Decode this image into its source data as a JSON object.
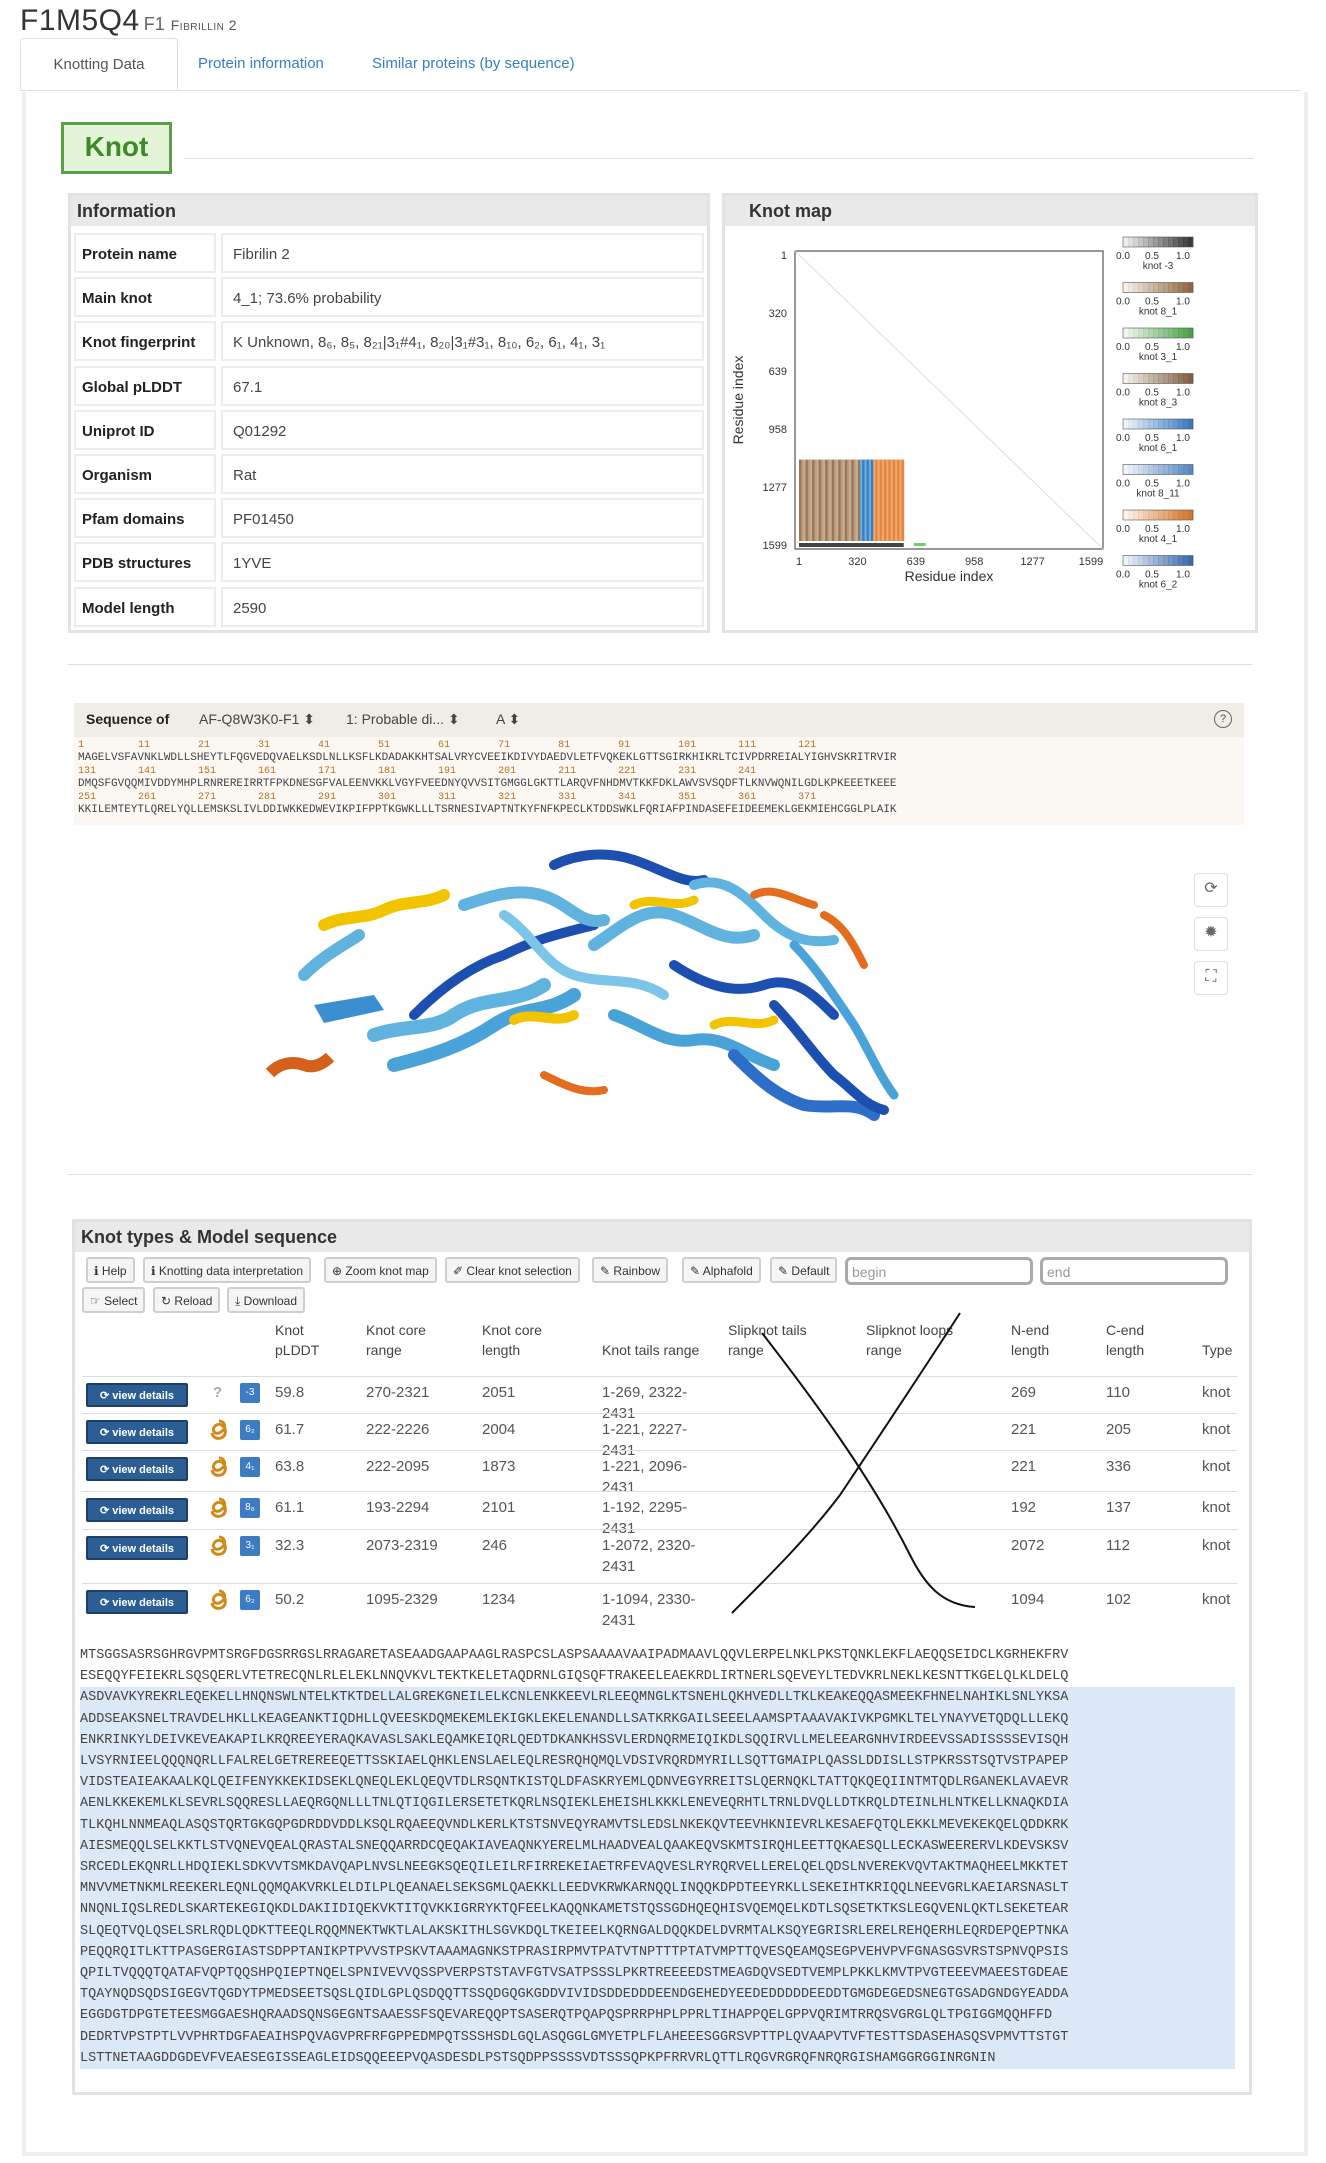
{
  "header": {
    "id": "F1M5Q4",
    "suffix": "F1",
    "name": "Fibrillin 2"
  },
  "tabs": [
    {
      "label": "Knotting Data",
      "active": true
    },
    {
      "label": "Protein information",
      "active": false
    },
    {
      "label": "Similar proteins (by sequence)",
      "active": false
    }
  ],
  "knot_title": "Knot",
  "information": {
    "title": "Information",
    "rows": [
      {
        "key": "Protein name",
        "value": "Fibrilin 2"
      },
      {
        "key": "Main knot",
        "value": "4_1; 73.6% probability"
      },
      {
        "key": "Knot fingerprint",
        "value": "K Unknown, 8₆, 8₅, 8₂₁|3₁#4₁, 8₂₀|3₁#3₁, 8₁₀, 6₂, 6₁, 4₁, 3₁"
      },
      {
        "key": "Global pLDDT",
        "value": "67.1"
      },
      {
        "key": "Uniprot ID",
        "value": "Q01292"
      },
      {
        "key": "Organism",
        "value": "Rat"
      },
      {
        "key": "Pfam domains",
        "value": "PF01450"
      },
      {
        "key": "PDB structures",
        "value": "1YVE"
      },
      {
        "key": "Model length",
        "value": "2590"
      }
    ]
  },
  "knot_map": {
    "title": "Knot map",
    "ylabel": "Residue index",
    "xlabel": "Residue index",
    "yticks": [
      "1",
      "320",
      "639",
      "958",
      "1277",
      "1599"
    ],
    "xticks": [
      "1",
      "320",
      "639",
      "958",
      "1277",
      "1599"
    ],
    "colorbar_ticks": [
      "0.0",
      "0.5",
      "1.0"
    ],
    "colorbars": [
      {
        "label": "knot -3",
        "color": "#2a2a2a"
      },
      {
        "label": "knot 8_1",
        "color": "#8a5a2e"
      },
      {
        "label": "knot 3_1",
        "color": "#3c9a3c"
      },
      {
        "label": "knot 8_3",
        "color": "#7a5230"
      },
      {
        "label": "knot 6_1",
        "color": "#2d6fb8"
      },
      {
        "label": "knot 8_11",
        "color": "#4a7fc0"
      },
      {
        "label": "knot 4_1",
        "color": "#d06a1c"
      },
      {
        "label": "knot 6_2",
        "color": "#2a5ea8"
      }
    ]
  },
  "sequence_viewer": {
    "label": "Sequence of",
    "entry": "AF-Q8W3K0-F1",
    "chain_desc": "1: Probable di...",
    "chain": "A",
    "line1_nums": "1         11        21        31        41        51        61        71        81        91        101       111       121",
    "line1": "MAGELVSFAVNKLWDLLSHEYTLFQGVEDQVAELKSDLNLLKSFLKDADAKKHTSALVRYCVEEIKDIVYDAEDVLETFVQKEKLGTTSGIRKHIKRLTCIVPDRREIALYIGHVSKRITRVIR",
    "line2_nums": "131       141       151       161       171       181       191       201       211       221       231       241",
    "line2": "DMQSFGVQQMIVDDYMHPLRNREREIRRTFPKDNESGFVALEENVKKLVGYFVEEDNYQVVSITGMGGLGKTTLARQVFNHDMVTKKFDKLAWVSVSQDFTLKNVWQNILGDLKPKEEETKEEE",
    "line3_nums": "251       261       271       281       291       301       311       321       331       341       351       361       371",
    "line3": "KKILEMTEYTLQRELYQLLEMSKSLIVLDDIWKKEDWEVIKPIFPPTKGWKLLLTSRNESIVAPTNTKYFNFKPECLKTDDSWKLFQRIAFPINDASEFEIDEEMEKLGEKMIEHCGGLPLAIK"
  },
  "knot_types": {
    "title": "Knot types & Model sequence",
    "buttons": [
      "Help",
      "Knotting data interpretation",
      "Zoom knot map",
      "Clear knot selection",
      "Rainbow",
      "Alphafold",
      "Default",
      "Select",
      "Reload",
      "Download"
    ],
    "begin_placeholder": "begin",
    "end_placeholder": "end",
    "columns": [
      "Knot pLDDT",
      "Knot core range",
      "Knot core length",
      "Knot tails range",
      "Slipknot tails range",
      "Slipknot loops range",
      "N-end length",
      "C-end length",
      "Type"
    ],
    "view_label": "view details",
    "rows": [
      {
        "badge": "-3",
        "icon": "unknown",
        "plddt": "59.8",
        "core": "270-2321",
        "core_len": "2051",
        "tails": "1-269, 2322-2431",
        "n_end": "269",
        "c_end": "110",
        "type": "knot"
      },
      {
        "badge": "6₂",
        "icon": "knot",
        "plddt": "61.7",
        "core": "222-2226",
        "core_len": "2004",
        "tails": "1-221, 2227-2431",
        "n_end": "221",
        "c_end": "205",
        "type": "knot"
      },
      {
        "badge": "4₁",
        "icon": "knot",
        "plddt": "63.8",
        "core": "222-2095",
        "core_len": "1873",
        "tails": "1-221, 2096-2431",
        "n_end": "221",
        "c_end": "336",
        "type": "knot"
      },
      {
        "badge": "8₈",
        "icon": "knot",
        "plddt": "61.1",
        "core": "193-2294",
        "core_len": "2101",
        "tails": "1-192, 2295-2431",
        "n_end": "192",
        "c_end": "137",
        "type": "knot"
      },
      {
        "badge": "3₁",
        "icon": "knot",
        "plddt": "32.3",
        "core": "2073-2319",
        "core_len": "246",
        "tails": "1-2072, 2320-2431",
        "n_end": "2072",
        "c_end": "112",
        "type": "knot"
      },
      {
        "badge": "6₂",
        "icon": "knot",
        "plddt": "50.2",
        "core": "1095-2329",
        "core_len": "1234",
        "tails": "1-1094, 2330-2431",
        "n_end": "1094",
        "c_end": "102",
        "type": "knot"
      }
    ]
  },
  "model_sequence": [
    "MTSGGSASRSGHRGVPMTSRGFDGSRRGSLRRAGARETASEAADGAAPAAGLRASPCSLASPSAAAAVAAIPADMAAVLQQVLERPELNKLPKSTQNKLEKFLAEQQSEIDCLKGRHEKFRV",
    "ESEQQYFEIEKRLSQSQERLVTETRECQNLRLELEKLNNQVKVLTEKTKELETAQDRNLGIQSQFTRAKEELEAEKRDLIRTNERLSQEVEYLTEDVKRLNEKLKESNTTKGELQLKLDELQ",
    "ASDVAVKYREKRLEQEKELLHNQNSWLNTELKTKTDELLALGREKGNEILELKCNLENKKEEVLRLEEQMNGLKTSNEHLQKHVEDLLTKLKEAKEQQASMEEKFHNELNAHIKLSNLYKSA",
    "ADDSEAKSNELTRAVDELHKLLKEAGEANKTIQDHLLQVEESKDQMEKEMLEKIGKLEKELENANDLLSATKRKGAILSEEELAAMSPTAAAVAKIVKPGMKLTELYNAYVETQDQLLLEKQ",
    "ENKRINKYLDEIVKEVEAKAPILKRQREEYERAQKAVASLSAKLEQAMKEIQRLQEDTDKANKHSSVLERDNQRMEIQIKDLSQQIRVLLMELEEARGNHVIRDEEVSSADISSSSEVISQH",
    "LVSYRNIEELQQQNQRLLFALRELGETREREEQETTSSKIAELQHKLENSLAELEQLRESRQHQMQLVDSIVRQRDMYRILLSQTTGMAIPLQASSLDDISLLSTPKRSSTSQTVSTPAPEP",
    "VIDSTEAIEAKAALKQLQEIFENYKKEKIDSEKLQNEQLEKLQEQVTDLRSQNTKISTQLDFASKRYEMLQDNVEGYRREITSLQERNQKLTATTQKQEQIINTMTQDLRGANEKLAVAEVR",
    "AENLKKEKEMLKLSEVRLSQQRESLLAEQRGQNLLLTNLQTIQGILERSETETKQRLNSQIEKLEHEISHLKKKLENEVEQRHTLTRNLDVQLLDTKRQLDTEINLHLNTKELLKNAQKDIA",
    "TLKQHLNNMEAQLASQSTQRTGKGQPGDRDDVDDLKSQLRQAEEQVNDLKERLKTSTSNVEQYRAMVTSLEDSLNKEKQVTEEVHKNIEVRLKESAEFQTQLEKKLMEVEKEKQELQDDKRK",
    "AIESMEQQLSELKKTLSTVQNEVQEALQRASTALSNEQQARRDCQEQAKIAVEAQNKYERELMLHAADVEALQAAKEQVSKMTSIRQHLEETTQKAESQLLECKASWEERERVLKDEVSKSV",
    "SRCEDLEKQNRLLHDQIEKLSDKVVTSMKDAVQAPLNVSLNEEGKSQEQILEILRFIRREKEIAETRFEVAQVESLRYRQRVELLERELQELQDSLNVEREKVQVTAKTMAQHEELMKKTET",
    "MNVVMETNKMLREEKERLEQNLQQMQAKVRKLELDILPLQEANAELSEKSGMLQAEKKLLEEDVKRWKARNQQLINQQKDPDTEEYRKLLSEKEIHTKRIQQLNEEVGRLKAEIARSNASLT",
    "NNQNLIQSLREDLSKARTEKEGIQKDLDAKIIDIQEKVKTITQVKKIGRRYKTQFEELKAQQNKAMETSTQSSGDHQEQHISVQEMQELKDTLSQSETKTKSLEGQVENLQKTLSEKETEAR",
    "SLQEQTVQLQSELSRLRQDLQDKTTEEQLRQQMNEKTWKTLALAKSKITHLSGVKDQLTKEIEELKQRNGALDQQKDELDVRMTALKSQYEGRISRLERELREHQERHLEQRDEPQEPTNKA",
    "PEQQRQITLKTTPASGERGIASTSDPPTANIKPTPVVSTPSKVTAAAMAGNKSTPRASIRPMVTPATVTNPTTTPTATVMPTTQVESQEAMQSEGPVEHVPVFGNASGSVRSTSPNVQPSIS",
    "QPILTVQQQTQATAFVQPTQQSHPQIEPTNQELSPNIVEVVQSSPVERPSTSTAVFGTVSATPSSSLPKRTREEEEDSTMEAGDQVSEDTVEMPLPKKLKMVTPVGTEEEVMAEESTGDEAE",
    "TQAYNQDSQDSIGEGVTQGDYTPMEDSEETSQSLQIDLGPLQSDQQTTSSQDGQGKGDDVIVIDSDDEDDDEENDGEHEDYEEDEDDDDDEEDDTGMGDEGEDSNEGTGSADGNDGYEADDA",
    "EGGDGTDPGTETEESMGGAESHQRAADSQNSGEGNTSAAESSFSQEVAREQQPTSASERQTPQAPQSPRRPHPLPPRLTIHAPPQELGPPVQRIMTRRQSVGRGLQLTPGIGGMQQHFFD",
    "DEDRTVPSTPTLVVPHRTDGFAEAIHSPQVAGVPRFRFGPPEDMPQTSSSHSDLGQLASQGGLGMYETPLFLAHEEESGGRSVPTTPLQVAAPVTVFTESTTSDASEHASQSVPMVTTSTGT",
    "LSTTNETAAGDDGDEVFVEAESEGISSEAGLEIDSQQEEEPVQASDESDLPSTSQDPPSSSSVDTSSSQPKPFRRVRLQTTLRQGVRGRQFNRQRGISHAMGGRGGINRGNIN"
  ],
  "colors": {
    "accent": "#3a7cc4",
    "knot_green": "#5aa046",
    "view_btn": "#2c5e93"
  }
}
